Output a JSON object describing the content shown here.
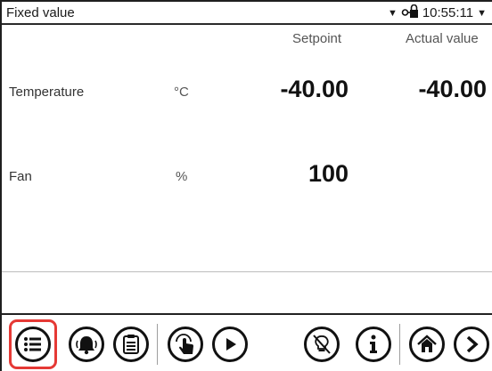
{
  "header": {
    "title": "Fixed value",
    "time": "10:55:11"
  },
  "columns": {
    "setpoint": "Setpoint",
    "actual": "Actual value"
  },
  "rows": [
    {
      "label": "Temperature",
      "unit": "°C",
      "setpoint": "-40.00",
      "actual": "-40.00"
    },
    {
      "label": "Fan",
      "unit": "%",
      "setpoint": "100"
    }
  ],
  "toolbar": {
    "buttons": [
      {
        "icon": "menu-list-icon",
        "active": true
      },
      {
        "icon": "alarm-bell-icon"
      },
      {
        "icon": "clipboard-icon"
      },
      {
        "icon": "touch-hand-icon"
      },
      {
        "icon": "play-icon"
      },
      {
        "icon": "lightbulb-icon"
      },
      {
        "icon": "info-icon"
      },
      {
        "icon": "home-icon"
      },
      {
        "icon": "next-arrow-icon"
      }
    ],
    "accent_color": "#e53935"
  }
}
